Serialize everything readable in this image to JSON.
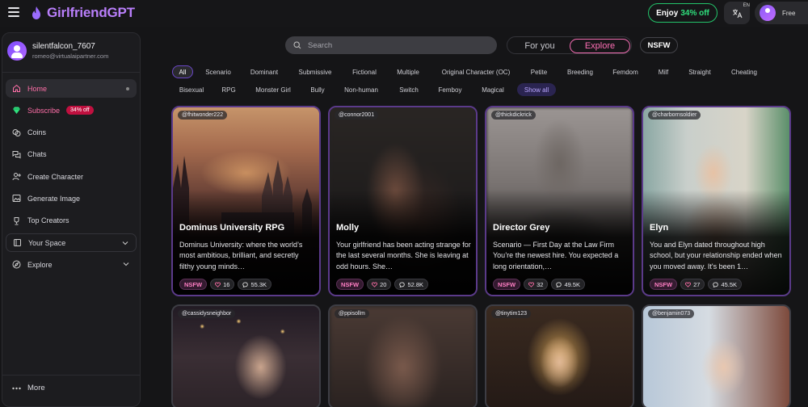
{
  "header": {
    "logo_text": "GirlfriendGPT",
    "promo_prefix": "Enjoy",
    "promo_pct": "34% off",
    "lang_code": "EN",
    "plan": "Free"
  },
  "profile": {
    "username": "silentfalcon_7607",
    "email": "romeo@virtualaipartner.com"
  },
  "nav": {
    "home": "Home",
    "subscribe": "Subscribe",
    "subscribe_badge": "34% off",
    "coins": "Coins",
    "chats": "Chats",
    "create_character": "Create Character",
    "generate_image": "Generate Image",
    "top_creators": "Top Creators",
    "your_space": "Your Space",
    "explore": "Explore",
    "more": "More"
  },
  "search": {
    "placeholder": "Search"
  },
  "feed_toggle": {
    "for_you": "For you",
    "explore": "Explore",
    "nsfw": "NSFW"
  },
  "tags": {
    "row1": [
      "All",
      "Scenario",
      "Dominant",
      "Submissive",
      "Fictional",
      "Multiple",
      "Original Character (OC)",
      "Petite",
      "Breeding",
      "Femdom",
      "Milf",
      "Straight",
      "Cheating"
    ],
    "row2": [
      "Bisexual",
      "RPG",
      "Monster Girl",
      "Bully",
      "Non-human",
      "Switch",
      "Femboy",
      "Magical"
    ],
    "show_all": "Show all"
  },
  "cards": [
    {
      "creator": "@fhitwonder222",
      "title": "Dominus University RPG",
      "desc": "Dominus University: where the world’s most ambitious, brilliant, and secretly filthy young minds…",
      "tag": "NSFW",
      "likes": "16",
      "chats": "55.3K"
    },
    {
      "creator": "@connor2001",
      "title": "Molly",
      "desc": "Your girlfriend has been acting strange for the last several months. She is leaving at odd hours. She…",
      "tag": "NSFW",
      "likes": "20",
      "chats": "52.8K"
    },
    {
      "creator": "@thickdickrick",
      "title": "Director Grey",
      "desc": "Scenario — First Day at the Law Firm You’re the newest hire. You expected a long orientation,…",
      "tag": "NSFW",
      "likes": "32",
      "chats": "49.5K"
    },
    {
      "creator": "@charbornsoldier",
      "title": "Elyn",
      "desc": "You and Elyn dated throughout high school, but your relationship ended when you moved away. It's been 1…",
      "tag": "NSFW",
      "likes": "27",
      "chats": "45.5K"
    },
    {
      "creator": "@cassidysneighbor"
    },
    {
      "creator": "@ppisollm"
    },
    {
      "creator": "@tinytim123"
    },
    {
      "creator": "@benjamin073"
    }
  ],
  "colors": {
    "accent_pink": "#ff6fa8",
    "accent_purple": "#b97ffb",
    "promo_green": "#23c46a",
    "badge_red": "#c0103f"
  }
}
